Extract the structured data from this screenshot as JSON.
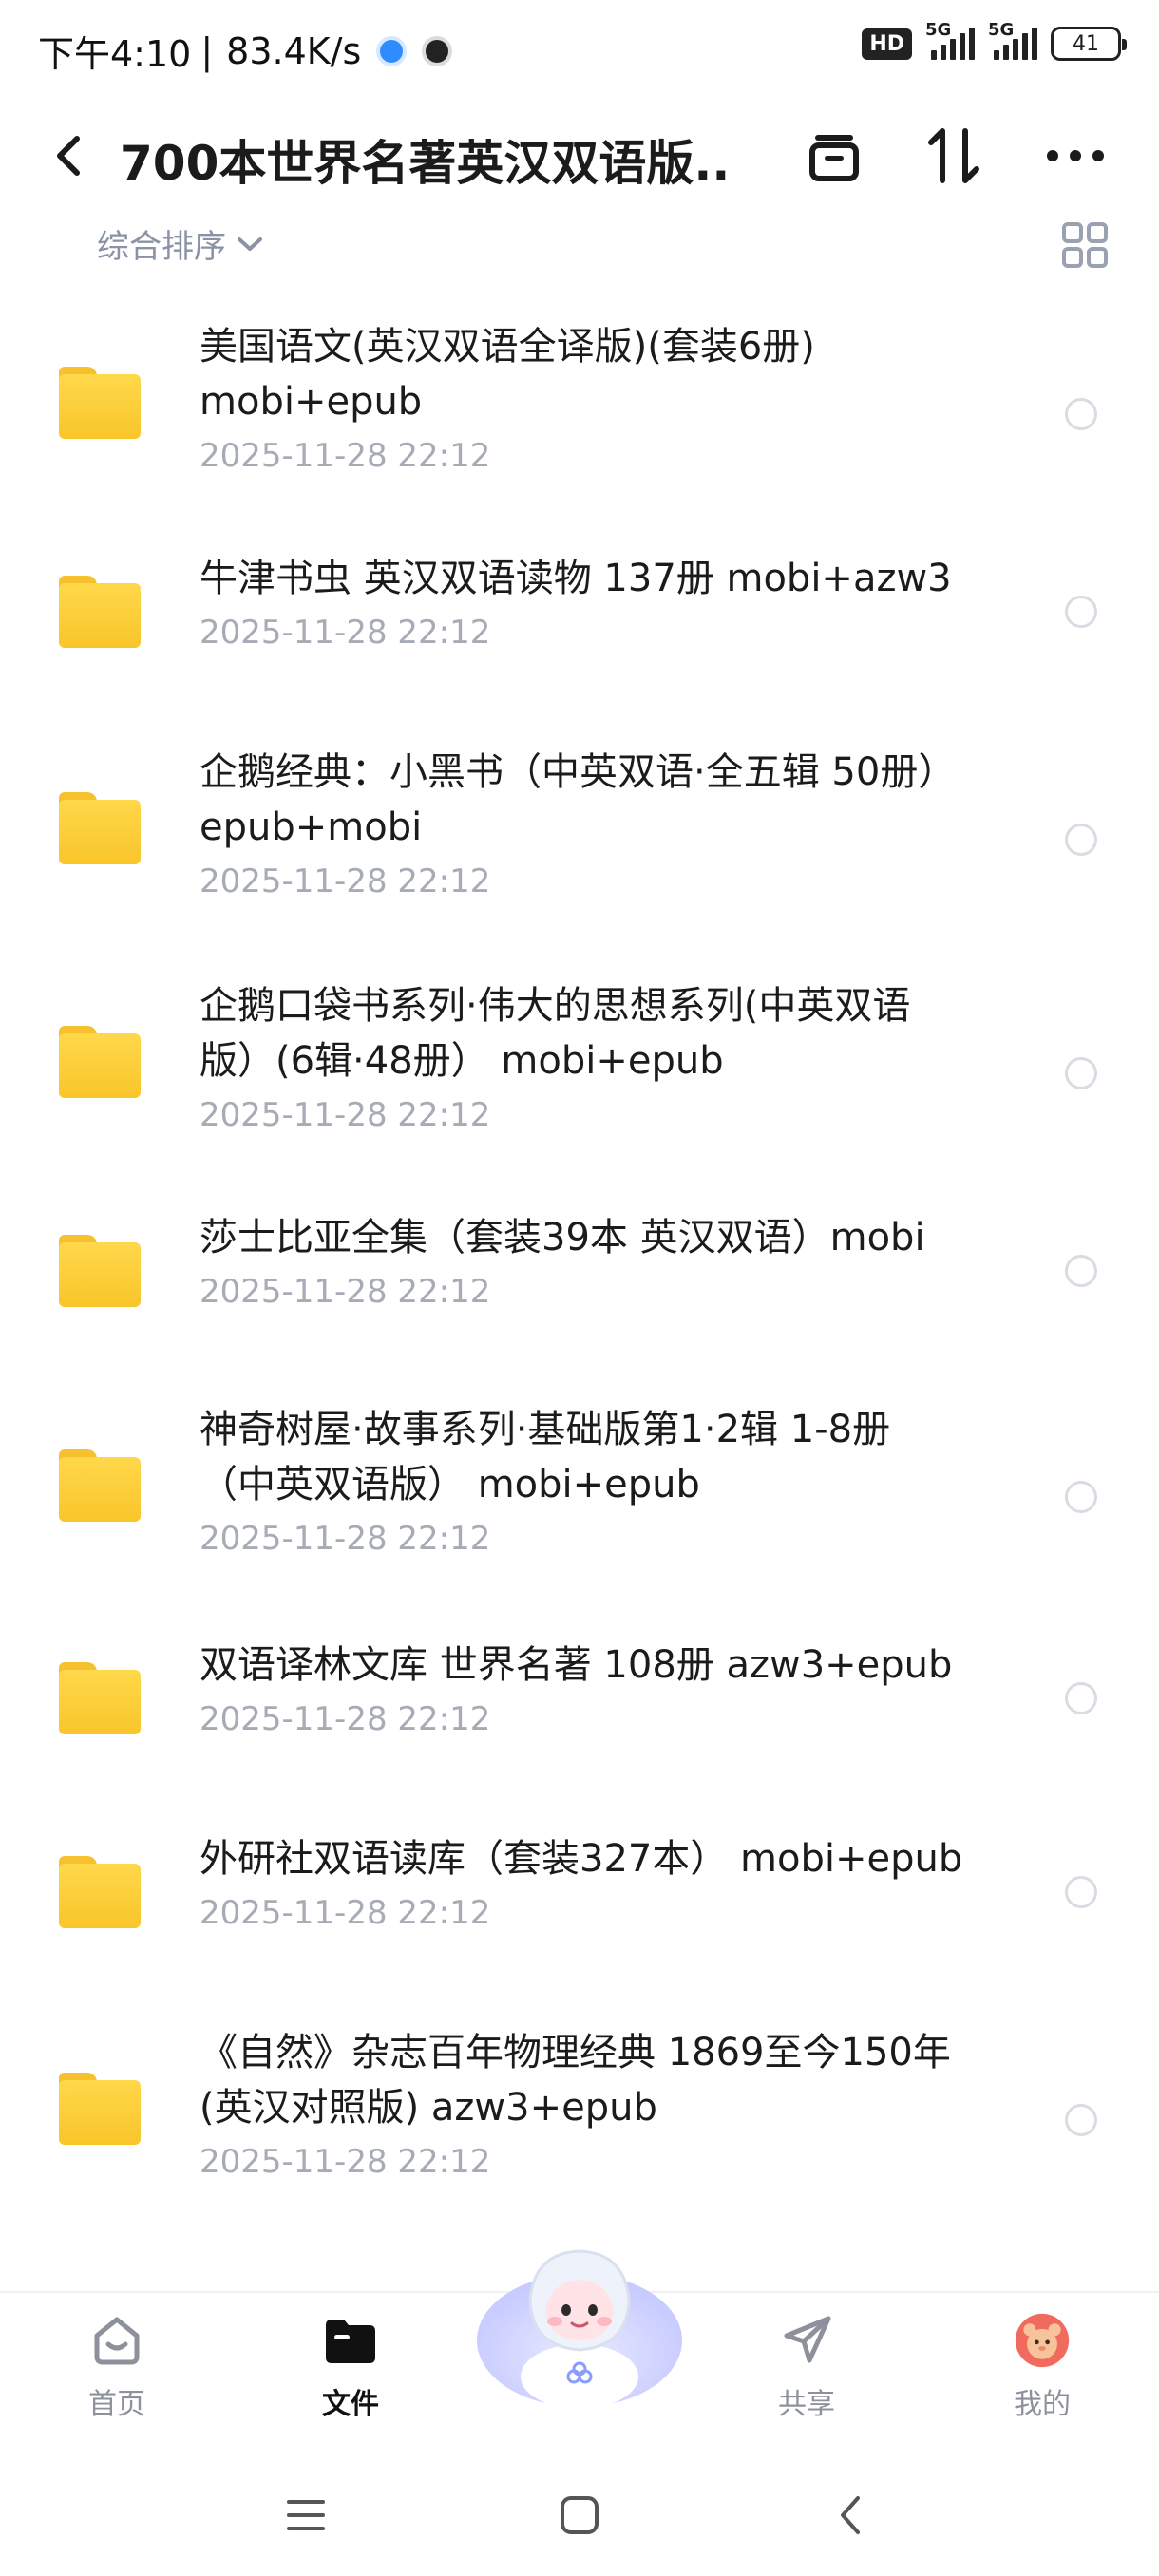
{
  "status_bar": {
    "time": "下午4:10",
    "separator": "|",
    "speed": "83.4K/s",
    "hd_badge": "HD",
    "sim1_label": "5G",
    "sim2_label": "5G",
    "battery": "41"
  },
  "header": {
    "title": "700本世界名著英汉双语版..."
  },
  "sort": {
    "label": "综合排序"
  },
  "files": [
    {
      "name_lines": [
        "美国语文(英汉双语全译版)(套装6册)",
        "mobi+epub"
      ],
      "date": "2025-11-28  22:12"
    },
    {
      "name_lines": [
        "牛津书虫 英汉双语读物 137册 mobi+azw3"
      ],
      "date": "2025-11-28  22:12"
    },
    {
      "name_lines": [
        "企鹅经典：小黑书（中英双语·全五辑 50册）",
        "epub+mobi"
      ],
      "date": "2025-11-28  22:12"
    },
    {
      "name_lines": [
        "企鹅口袋书系列·伟大的思想系列(中英双语",
        "版）(6辑·48册） mobi+epub"
      ],
      "date": "2025-11-28  22:12"
    },
    {
      "name_lines": [
        "莎士比亚全集（套装39本 英汉双语）mobi"
      ],
      "date": "2025-11-28  22:12"
    },
    {
      "name_lines": [
        "神奇树屋·故事系列·基础版第1·2辑 1-8册",
        "（中英双语版） mobi+epub"
      ],
      "date": "2025-11-28  22:12"
    },
    {
      "name_lines": [
        "双语译林文库 世界名著 108册 azw3+epub"
      ],
      "date": "2025-11-28  22:12"
    },
    {
      "name_lines": [
        "外研社双语读库（套装327本） mobi+epub"
      ],
      "date": "2025-11-28  22:12"
    },
    {
      "name_lines": [
        "《自然》杂志百年物理经典 1869至今150年",
        "(英汉对照版) azw3+epub"
      ],
      "date": "2025-11-28  22:12"
    }
  ],
  "tab_bar": {
    "home": "首页",
    "files": "文件",
    "share": "共享",
    "mine": "我的"
  },
  "colors": {
    "folder": "#f9c52a",
    "date_text": "#a6abb6",
    "sort_text": "#8a93a5"
  }
}
